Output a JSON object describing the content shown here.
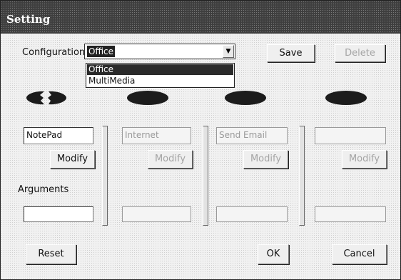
{
  "window": {
    "title": "Setting"
  },
  "configuration": {
    "label": "Configuration",
    "selected": "Office",
    "options": [
      "Office",
      "MultiMedia"
    ],
    "dropdown_open": true
  },
  "buttons": {
    "save": "Save",
    "delete": "Delete",
    "reset": "Reset",
    "ok": "OK",
    "cancel": "Cancel",
    "modify": "Modify"
  },
  "slots": [
    {
      "program": "NotePad",
      "enabled": true,
      "indicator": "broken"
    },
    {
      "program": "Internet",
      "enabled": false,
      "indicator": "solid"
    },
    {
      "program": "Send Email",
      "enabled": false,
      "indicator": "solid"
    },
    {
      "program": "",
      "enabled": false,
      "indicator": "solid"
    }
  ],
  "arguments": {
    "label": "Arguments",
    "value": ""
  }
}
